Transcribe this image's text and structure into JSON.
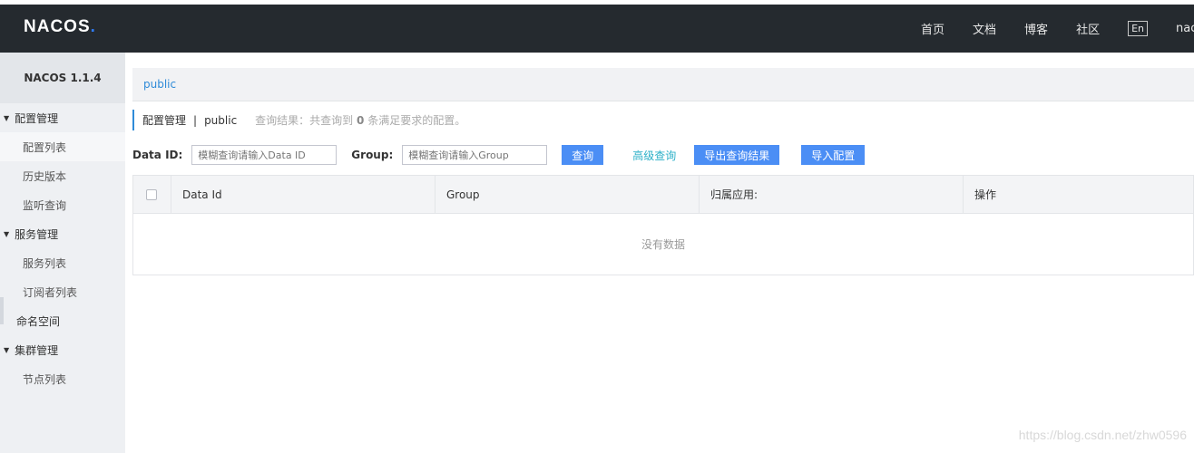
{
  "header": {
    "logo_main": "NACOS",
    "logo_dot": ".",
    "nav": [
      "首页",
      "文档",
      "博客",
      "社区"
    ],
    "lang": "En",
    "user": "nacos"
  },
  "sidebar": {
    "version": "NACOS 1.1.4",
    "groups": {
      "config": "配置管理",
      "service": "服务管理",
      "cluster": "集群管理"
    },
    "items": {
      "config_list": "配置列表",
      "history": "历史版本",
      "listener": "监听查询",
      "service_list": "服务列表",
      "subscriber": "订阅者列表",
      "namespace": "命名空间",
      "node_list": "节点列表"
    }
  },
  "breadcrumb": {
    "namespace": "public"
  },
  "title": {
    "main": "配置管理",
    "separator": "|",
    "namespace": "public",
    "result_prefix": "查询结果：共查询到",
    "result_count": "0",
    "result_suffix": "条满足要求的配置。"
  },
  "filter": {
    "dataid_label": "Data ID:",
    "dataid_placeholder": "模糊查询请输入Data ID",
    "group_label": "Group:",
    "group_placeholder": "模糊查询请输入Group",
    "query_btn": "查询",
    "advanced": "高级查询",
    "export_btn": "导出查询结果",
    "import_btn": "导入配置"
  },
  "table": {
    "columns": [
      "Data Id",
      "Group",
      "归属应用:",
      "操作"
    ],
    "empty": "没有数据"
  },
  "watermark": "https://blog.csdn.net/zhw0596"
}
